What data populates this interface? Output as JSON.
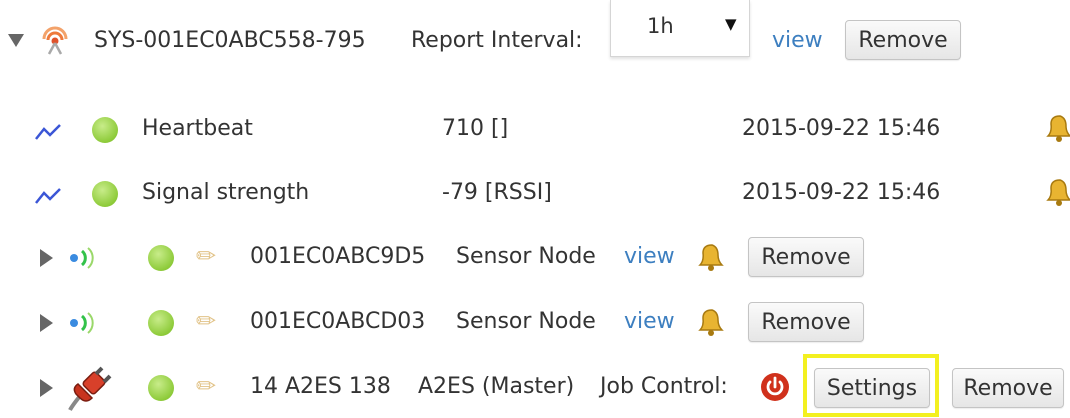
{
  "system": {
    "id": "SYS-001EC0ABC558-795",
    "report_interval_label": "Report Interval:",
    "report_interval_value": "1h",
    "view_label": "view",
    "remove_label": "Remove"
  },
  "metrics": [
    {
      "name": "Heartbeat",
      "value": "710 []",
      "timestamp": "2015-09-22 15:46"
    },
    {
      "name": "Signal strength",
      "value": "-79 [RSSI]",
      "timestamp": "2015-09-22 15:46"
    }
  ],
  "nodes": [
    {
      "id": "001EC0ABC9D5",
      "type": "Sensor Node",
      "view_label": "view",
      "remove_label": "Remove"
    },
    {
      "id": "001EC0ABCD03",
      "type": "Sensor Node",
      "view_label": "view",
      "remove_label": "Remove"
    }
  ],
  "master": {
    "id": "14 A2ES 138",
    "type": "A2ES (Master)",
    "job_control_label": "Job Control:",
    "settings_label": "Settings",
    "remove_label": "Remove"
  },
  "colors": {
    "link": "#3d7fc0",
    "status_ok": "#8ecb3a",
    "highlight": "#f3f020",
    "power": "#d0311c"
  },
  "icons": {
    "system": "gateway-signal-icon",
    "metric": "chart-line-icon",
    "sensor": "wireless-sensor-icon",
    "master": "plug-icon",
    "alarm": "bell-icon",
    "edit": "pencil-icon",
    "power": "power-icon"
  }
}
